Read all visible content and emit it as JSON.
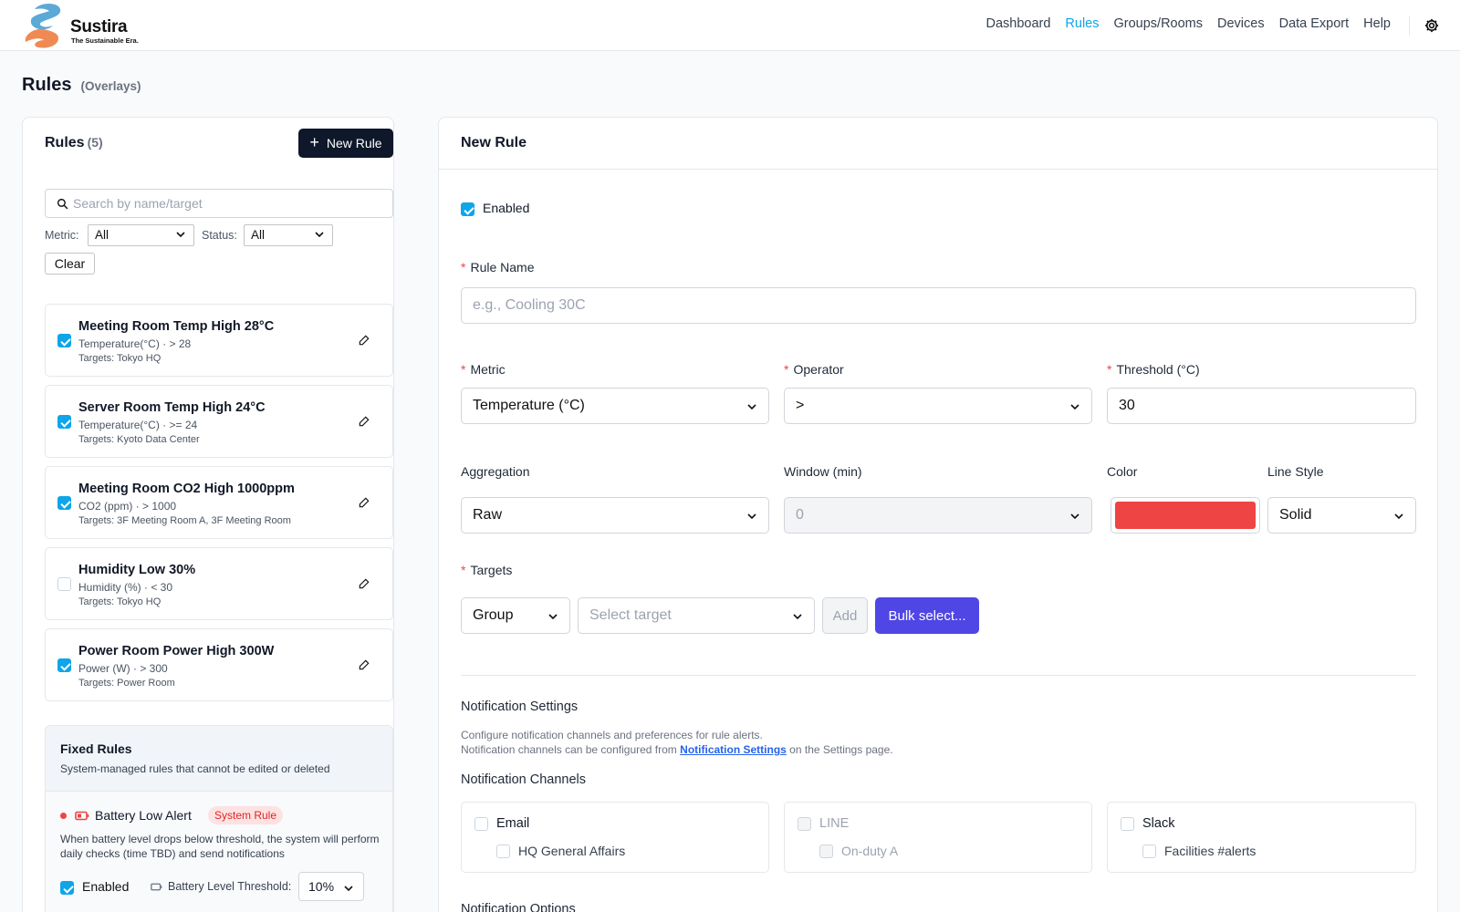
{
  "brand": {
    "name": "Sustira",
    "tagline": "The Sustainable Era."
  },
  "nav": {
    "items": [
      "Dashboard",
      "Rules",
      "Groups/Rooms",
      "Devices",
      "Data Export",
      "Help"
    ],
    "active": "Rules"
  },
  "page": {
    "title": "Rules",
    "subtitle": "(Overlays)"
  },
  "rules_panel": {
    "title": "Rules",
    "count": "(5)",
    "new_button": "New Rule",
    "search_placeholder": "Search by name/target",
    "metric_label": "Metric:",
    "metric_value": "All",
    "status_label": "Status:",
    "status_value": "All",
    "clear_button": "Clear",
    "rules": [
      {
        "title": "Meeting Room Temp High 28°C",
        "meta": "Temperature(°C) · > 28",
        "targets": "Targets: Tokyo HQ",
        "enabled": true
      },
      {
        "title": "Server Room Temp High 24°C",
        "meta": "Temperature(°C) · >= 24",
        "targets": "Targets: Kyoto Data Center",
        "enabled": true
      },
      {
        "title": "Meeting Room CO2 High 1000ppm",
        "meta": "CO2 (ppm) · > 1000",
        "targets": "Targets: 3F Meeting Room A, 3F Meeting Room",
        "enabled": true
      },
      {
        "title": "Humidity Low 30%",
        "meta": "Humidity (%) · < 30",
        "targets": "Targets: Tokyo HQ",
        "enabled": false
      },
      {
        "title": "Power Room Power High 300W",
        "meta": "Power (W) · > 300",
        "targets": "Targets: Power Room",
        "enabled": true
      }
    ],
    "fixed": {
      "title": "Fixed Rules",
      "subtitle": "System-managed rules that cannot be edited or deleted",
      "alert_name": "Battery Low Alert",
      "badge": "System Rule",
      "description": "When battery level drops below threshold, the system will perform daily checks (time TBD) and send notifications",
      "enabled_label": "Enabled",
      "threshold_label": "Battery Level Threshold:",
      "threshold_value": "10%"
    }
  },
  "form": {
    "title": "New Rule",
    "enabled_label": "Enabled",
    "rule_name_label": "Rule Name",
    "rule_name_placeholder": "e.g., Cooling 30C",
    "metric_label": "Metric",
    "metric_value": "Temperature (°C)",
    "operator_label": "Operator",
    "operator_value": ">",
    "threshold_label": "Threshold (°C)",
    "threshold_value": "30",
    "aggregation_label": "Aggregation",
    "aggregation_value": "Raw",
    "window_label": "Window (min)",
    "window_value": "0",
    "color_label": "Color",
    "color_value": "#ef4444",
    "line_style_label": "Line Style",
    "line_style_value": "Solid",
    "targets_label": "Targets",
    "target_type": "Group",
    "target_placeholder": "Select target",
    "add_button": "Add",
    "bulk_button": "Bulk select...",
    "notif_title": "Notification Settings",
    "notif_desc1": "Configure notification channels and preferences for rule alerts.",
    "notif_desc2_pre": "Notification channels can be configured from",
    "notif_link": "Notification Settings",
    "notif_desc2_post": "on the Settings page.",
    "channels_title": "Notification Channels",
    "channels": [
      {
        "name": "Email",
        "sub": "HQ General Affairs",
        "disabled": false
      },
      {
        "name": "LINE",
        "sub": "On-duty A",
        "disabled": true
      },
      {
        "name": "Slack",
        "sub": "Facilities #alerts",
        "disabled": false
      }
    ],
    "options_title": "Notification Options"
  },
  "colors": {
    "accent": "#0ea5e9",
    "primary_dark": "#0f172a",
    "bulk": "#4f46e5",
    "danger": "#ef4444"
  },
  "icons": [
    "search-icon",
    "plus-icon",
    "chevron-down-icon",
    "pencil-icon",
    "battery-icon",
    "gear-icon",
    "checkbox-icon"
  ]
}
